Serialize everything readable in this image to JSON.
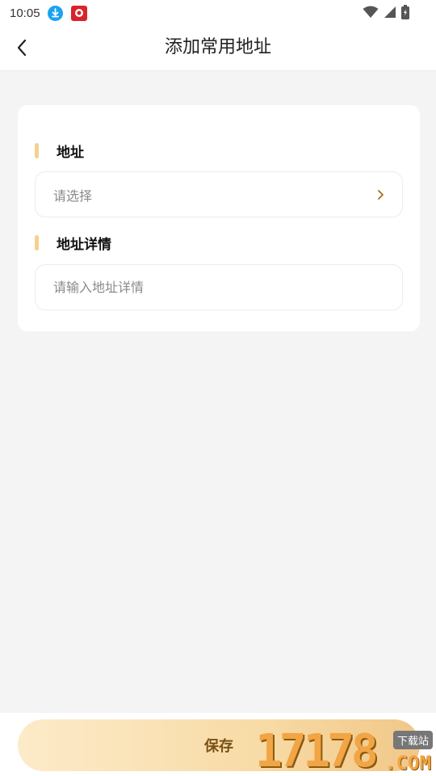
{
  "status_bar": {
    "time": "10:05"
  },
  "header": {
    "title": "添加常用地址"
  },
  "form": {
    "address_label": "地址",
    "address_placeholder": "请选择",
    "detail_label": "地址详情",
    "detail_placeholder": "请输入地址详情"
  },
  "footer": {
    "save_label": "保存"
  },
  "watermark": {
    "number": "17178",
    "badge": "下载站",
    "suffix": ".COM"
  },
  "colors": {
    "accent_bar": "#f5d18d",
    "save_text": "#7a5216",
    "button_gradient_start": "#fcebc9",
    "button_gradient_end": "#f1c788"
  },
  "icons": [
    "download-icon",
    "app-icon",
    "wifi-icon",
    "signal-icon",
    "battery-icon",
    "back-arrow-icon",
    "chevron-right-icon"
  ]
}
